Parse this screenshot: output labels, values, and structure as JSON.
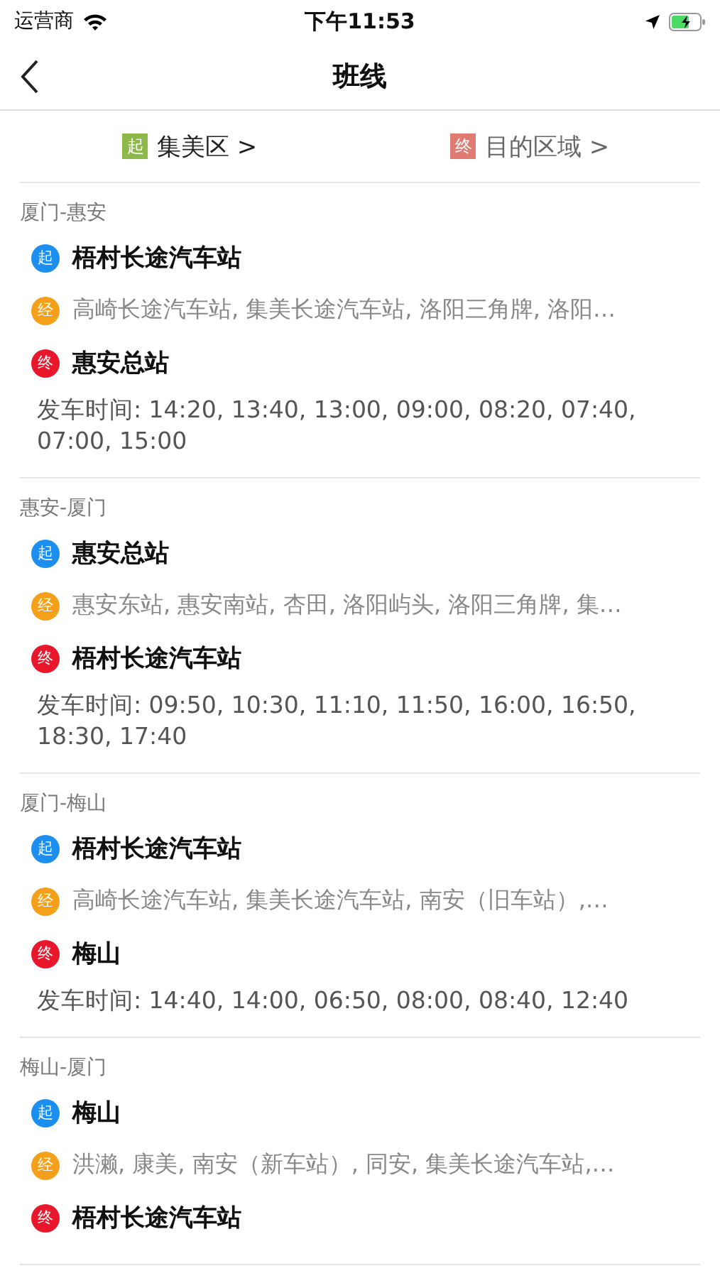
{
  "status_bar": {
    "carrier": "运营商",
    "time": "下午11:53"
  },
  "nav": {
    "title": "班线"
  },
  "filters": [
    {
      "badge": "起",
      "label": "集美区 >",
      "kind": "origin"
    },
    {
      "badge": "终",
      "label": "目的区域 >",
      "kind": "destination"
    }
  ],
  "routes": [
    {
      "name": "厦门-惠安",
      "stops": [
        {
          "kind": "start",
          "badge": "起",
          "text": "梧村长途汽车站"
        },
        {
          "kind": "via",
          "badge": "经",
          "text": "高崎长途汽车站, 集美长途汽车站, 洛阳三角牌, 洛阳…"
        },
        {
          "kind": "end",
          "badge": "终",
          "text": "惠安总站"
        }
      ],
      "departures": "发车时间: 14:20, 13:40, 13:00, 09:00, 08:20, 07:40, 07:00, 15:00"
    },
    {
      "name": "惠安-厦门",
      "stops": [
        {
          "kind": "start",
          "badge": "起",
          "text": "惠安总站"
        },
        {
          "kind": "via",
          "badge": "经",
          "text": "惠安东站, 惠安南站, 杏田, 洛阳屿头, 洛阳三角牌, 集…"
        },
        {
          "kind": "end",
          "badge": "终",
          "text": "梧村长途汽车站"
        }
      ],
      "departures": "发车时间: 09:50, 10:30, 11:10, 11:50, 16:00, 16:50, 18:30, 17:40"
    },
    {
      "name": "厦门-梅山",
      "stops": [
        {
          "kind": "start",
          "badge": "起",
          "text": "梧村长途汽车站"
        },
        {
          "kind": "via",
          "badge": "经",
          "text": "高崎长途汽车站, 集美长途汽车站, 南安（旧车站）,…"
        },
        {
          "kind": "end",
          "badge": "终",
          "text": "梅山"
        }
      ],
      "departures": "发车时间: 14:40, 14:00, 06:50, 08:00, 08:40, 12:40"
    },
    {
      "name": "梅山-厦门",
      "stops": [
        {
          "kind": "start",
          "badge": "起",
          "text": "梅山"
        },
        {
          "kind": "via",
          "badge": "经",
          "text": "洪濑, 康美, 南安（新车站）, 同安, 集美长途汽车站,…"
        },
        {
          "kind": "end",
          "badge": "终",
          "text": "梧村长途汽车站"
        }
      ]
    }
  ]
}
